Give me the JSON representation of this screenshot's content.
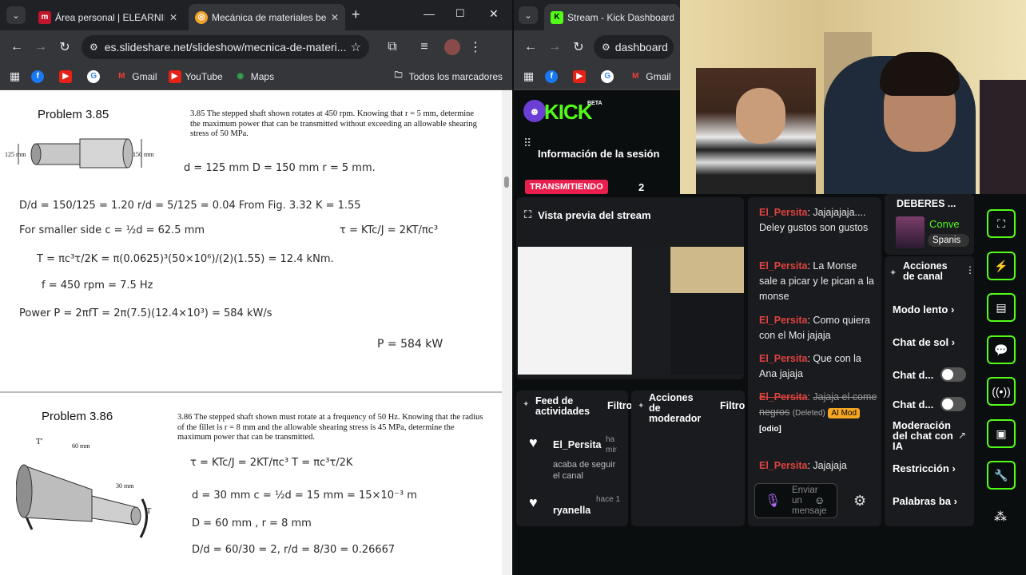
{
  "left_browser": {
    "tabs": [
      {
        "title": "Área personal | ELEARNING",
        "active": false
      },
      {
        "title": "Mecánica de materiales be",
        "active": true
      }
    ],
    "url": "es.slideshare.net/slideshow/mecnica-de-materi...",
    "bookmarks": [
      "Gmail",
      "YouTube",
      "Maps"
    ],
    "all_bookmarks": "Todos los marcadores"
  },
  "doc": {
    "p1_title": "Problem 3.85",
    "p1_text": "3.85  The stepped shaft shown rotates at 450 rpm. Knowing that r = 5 mm, determine the maximum power that can be transmitted without exceeding an allowable shearing stress of 50 MPa.",
    "p1_dims": [
      "125 mm",
      "150 mm"
    ],
    "p1_work": [
      "d = 125 mm    D = 150 mm     r = 5 mm.",
      "D/d = 150/125 = 1.20     r/d = 5/125 = 0.04     From Fig. 3.32   K = 1.55",
      "For smaller side      c = ½d = 62.5 mm",
      "τ = KTc/J = 2KT/πc³",
      "T = πc³τ/2K = π(0.0625)³(50×10⁶)/(2)(1.55) = 12.4 kNm.",
      "f = 450 rpm = 7.5 Hz",
      "Power   P = 2πfT = 2π(7.5)(12.4×10³) = 584 kW/s",
      "P = 584 kW"
    ],
    "p2_title": "Problem 3.86",
    "p2_text": "3.86  The stepped shaft shown must rotate at a frequency of 50 Hz. Knowing that the radius of the fillet is r = 8 mm and the allowable shearing stress is 45 MPa, determine the maximum power that can be transmitted.",
    "p2_dims": [
      "T'",
      "60 mm",
      "30 mm",
      "T"
    ],
    "p2_work": [
      "τ = KTc/J = 2KT/πc³       T = πc³τ/2K",
      "d = 30 mm        c = ½d = 15 mm = 15×10⁻³ m",
      "D = 60 mm ,   r = 8 mm",
      "D/d = 60/30 = 2,    r/d = 8/30 = 0.26667"
    ]
  },
  "mid_browser": {
    "tab_title": "Stream - Kick Dashboard",
    "url": "dashboard",
    "bookmarks": [
      "Gmail"
    ],
    "logo": "KICK",
    "logo_badge": "BETA",
    "session_title": "Información de la sesión",
    "live_badge": "TRANSMITIENDO",
    "viewers": "2"
  },
  "dashboard": {
    "preview_title": "Vista previa del stream",
    "activity_title": "Feed de actividades",
    "activity_filter": "Filtro",
    "activity_items": [
      {
        "user": "El_Persita",
        "text": "acaba de seguir el canal",
        "time": "ha mir"
      },
      {
        "user": "ryanella",
        "text": "",
        "time": "hace 1"
      }
    ],
    "mod_title": "Acciones de moderador",
    "mod_filter": "Filtro",
    "chat": [
      {
        "user": "El_Persita",
        "text": "Jajajajaja.... Deley gustos son gustos"
      },
      {
        "user": "El_Persita",
        "text": "La Monse sale a picar y le pican a la monse"
      },
      {
        "user": "El_Persita",
        "text": "Como quiera con el Moi jajaja"
      },
      {
        "user": "El_Persita",
        "text": "Que con la Ana jajaja"
      },
      {
        "user": "El_Persita",
        "text": "Jajaja el come negros",
        "deleted": "(Deleted)",
        "badge": "AI Mod",
        "tag": "[odio]"
      },
      {
        "user": "El_Persita",
        "text": "Jajajaja"
      }
    ],
    "chat_placeholder": "Enviar un mensaje",
    "deberes_title": "DEBERES ...",
    "deberes_tag1": "Conve",
    "deberes_tag2": "Spanis",
    "channel_actions_title": "Acciones de canal",
    "channel_actions": [
      {
        "label": "Modo lento",
        "type": "arrow"
      },
      {
        "label": "Chat de sol",
        "type": "arrow"
      },
      {
        "label": "Chat d...",
        "type": "toggle"
      },
      {
        "label": "Chat d...",
        "type": "toggle"
      },
      {
        "label": "Moderación del chat con IA",
        "type": "external"
      },
      {
        "label": "Restricción",
        "type": "arrow"
      },
      {
        "label": "Palabras ba",
        "type": "arrow"
      }
    ]
  }
}
